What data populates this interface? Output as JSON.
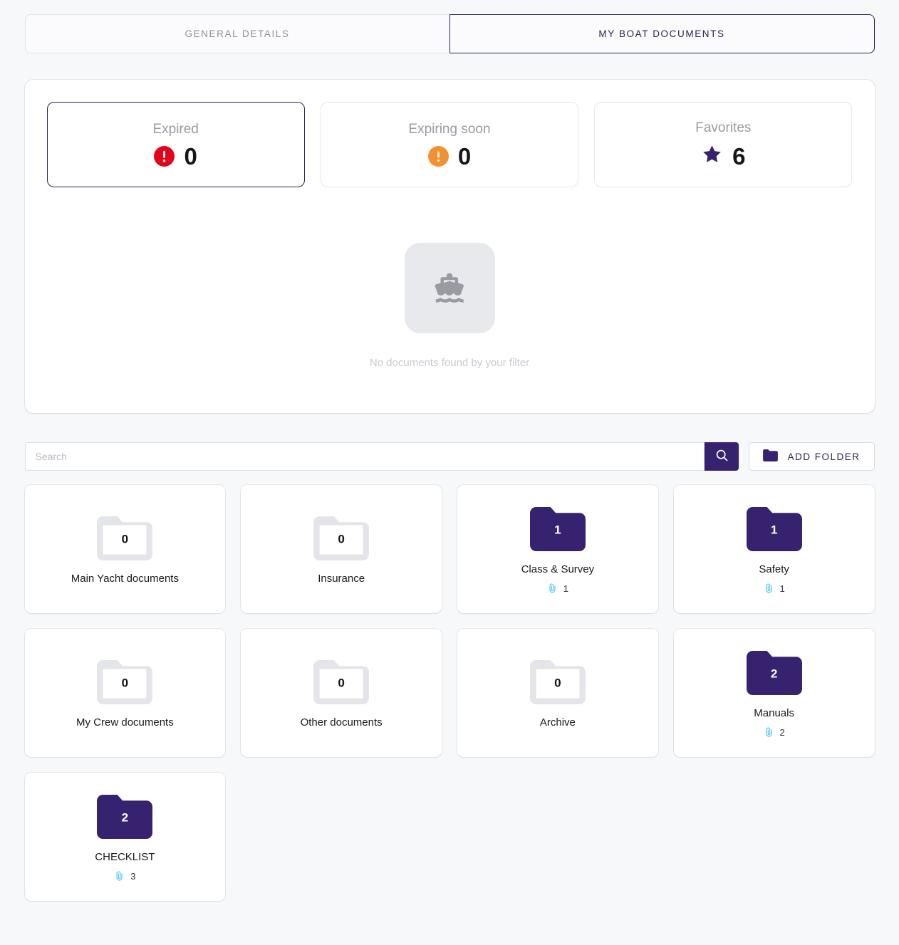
{
  "tabs": [
    {
      "id": "general-details",
      "label": "GENERAL DETAILS",
      "active": false
    },
    {
      "id": "my-boat-documents",
      "label": "MY BOAT DOCUMENTS",
      "active": true
    }
  ],
  "stats": [
    {
      "id": "expired",
      "label": "Expired",
      "value": "0",
      "icon": "exclamation-circle-icon",
      "icon_glyph": "!",
      "color": "#e2051b",
      "selected": true
    },
    {
      "id": "expiring-soon",
      "label": "Expiring soon",
      "value": "0",
      "icon": "exclamation-circle-icon",
      "icon_glyph": "!",
      "color": "#f29130",
      "selected": false
    },
    {
      "id": "favorites",
      "label": "Favorites",
      "value": "6",
      "icon": "star-icon",
      "icon_glyph": "★",
      "color": "#37226f",
      "selected": false
    }
  ],
  "empty_state": {
    "icon": "boat-icon",
    "caption": "No documents found by your filter"
  },
  "search": {
    "placeholder": "Search",
    "value": "",
    "button_icon": "search-icon"
  },
  "add_folder": {
    "label": "ADD FOLDER",
    "icon": "folder-icon"
  },
  "colors": {
    "accent": "#37226f",
    "tab_active_border": "#2c2250",
    "danger": "#e2051b",
    "warning": "#f29130",
    "clip": "#5bc8f5",
    "page_bg": "#f7f8fa",
    "empty_folder": "#e4e5ea"
  },
  "folders": [
    {
      "id": "main-yacht-documents",
      "name": "Main Yacht documents",
      "count": "0",
      "filled": false,
      "attachments": null
    },
    {
      "id": "insurance",
      "name": "Insurance",
      "count": "0",
      "filled": false,
      "attachments": null
    },
    {
      "id": "class-and-survey",
      "name": "Class & Survey",
      "count": "1",
      "filled": true,
      "attachments": "1"
    },
    {
      "id": "safety",
      "name": "Safety",
      "count": "1",
      "filled": true,
      "attachments": "1"
    },
    {
      "id": "my-crew-documents",
      "name": "My Crew documents",
      "count": "0",
      "filled": false,
      "attachments": null
    },
    {
      "id": "other-documents",
      "name": "Other documents",
      "count": "0",
      "filled": false,
      "attachments": null
    },
    {
      "id": "archive",
      "name": "Archive",
      "count": "0",
      "filled": false,
      "attachments": null
    },
    {
      "id": "manuals",
      "name": "Manuals",
      "count": "2",
      "filled": true,
      "attachments": "2"
    },
    {
      "id": "checklist",
      "name": "CHECKLIST",
      "count": "2",
      "filled": true,
      "attachments": "3"
    }
  ]
}
